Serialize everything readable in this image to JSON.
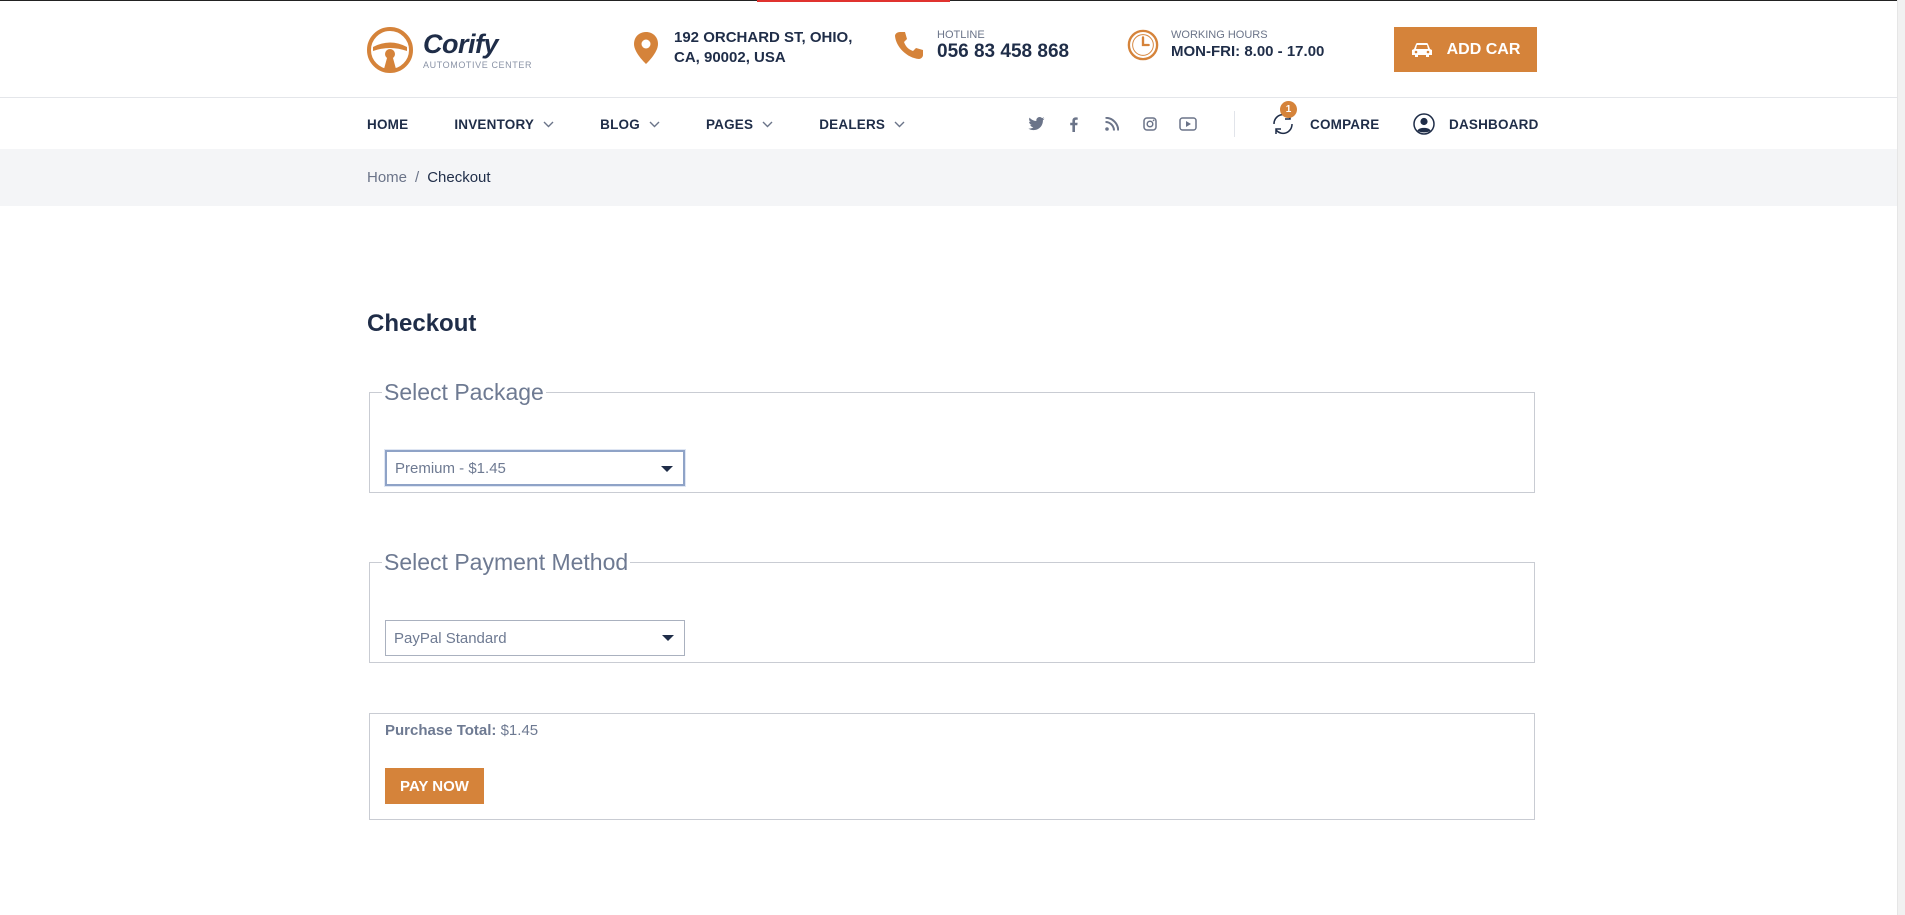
{
  "brand": {
    "name": "Corify",
    "tagline": "AUTOMOTIVE CENTER",
    "accent_color": "#d5833a",
    "text_color": "#1f2d48"
  },
  "header": {
    "address_line1": "192 ORCHARD ST, OHIO,",
    "address_line2": "CA, 90002, USA",
    "hotline_label": "HOTLINE",
    "hotline_value": "056 83 458 868",
    "hours_label": "WORKING HOURS",
    "hours_value": "MON-FRI: 8.00 - 17.00",
    "add_car_label": "ADD CAR"
  },
  "nav": {
    "items": [
      {
        "label": "HOME",
        "dropdown": false
      },
      {
        "label": "INVENTORY",
        "dropdown": true
      },
      {
        "label": "BLOG",
        "dropdown": true
      },
      {
        "label": "PAGES",
        "dropdown": true
      },
      {
        "label": "DEALERS",
        "dropdown": true
      }
    ],
    "socials": [
      "twitter-icon",
      "facebook-icon",
      "rss-icon",
      "instagram-icon",
      "youtube-icon"
    ],
    "compare_label": "COMPARE",
    "compare_count": "1",
    "dashboard_label": "DASHBOARD"
  },
  "breadcrumb": {
    "home": "Home",
    "separator": "/",
    "current": "Checkout"
  },
  "checkout": {
    "title": "Checkout",
    "package_legend": "Select Package",
    "package_selected": "Premium - $1.45",
    "payment_legend": "Select Payment Method",
    "payment_selected": "PayPal Standard",
    "total_label": "Purchase Total:",
    "total_value": "$1.45",
    "pay_button": "PAY NOW"
  }
}
